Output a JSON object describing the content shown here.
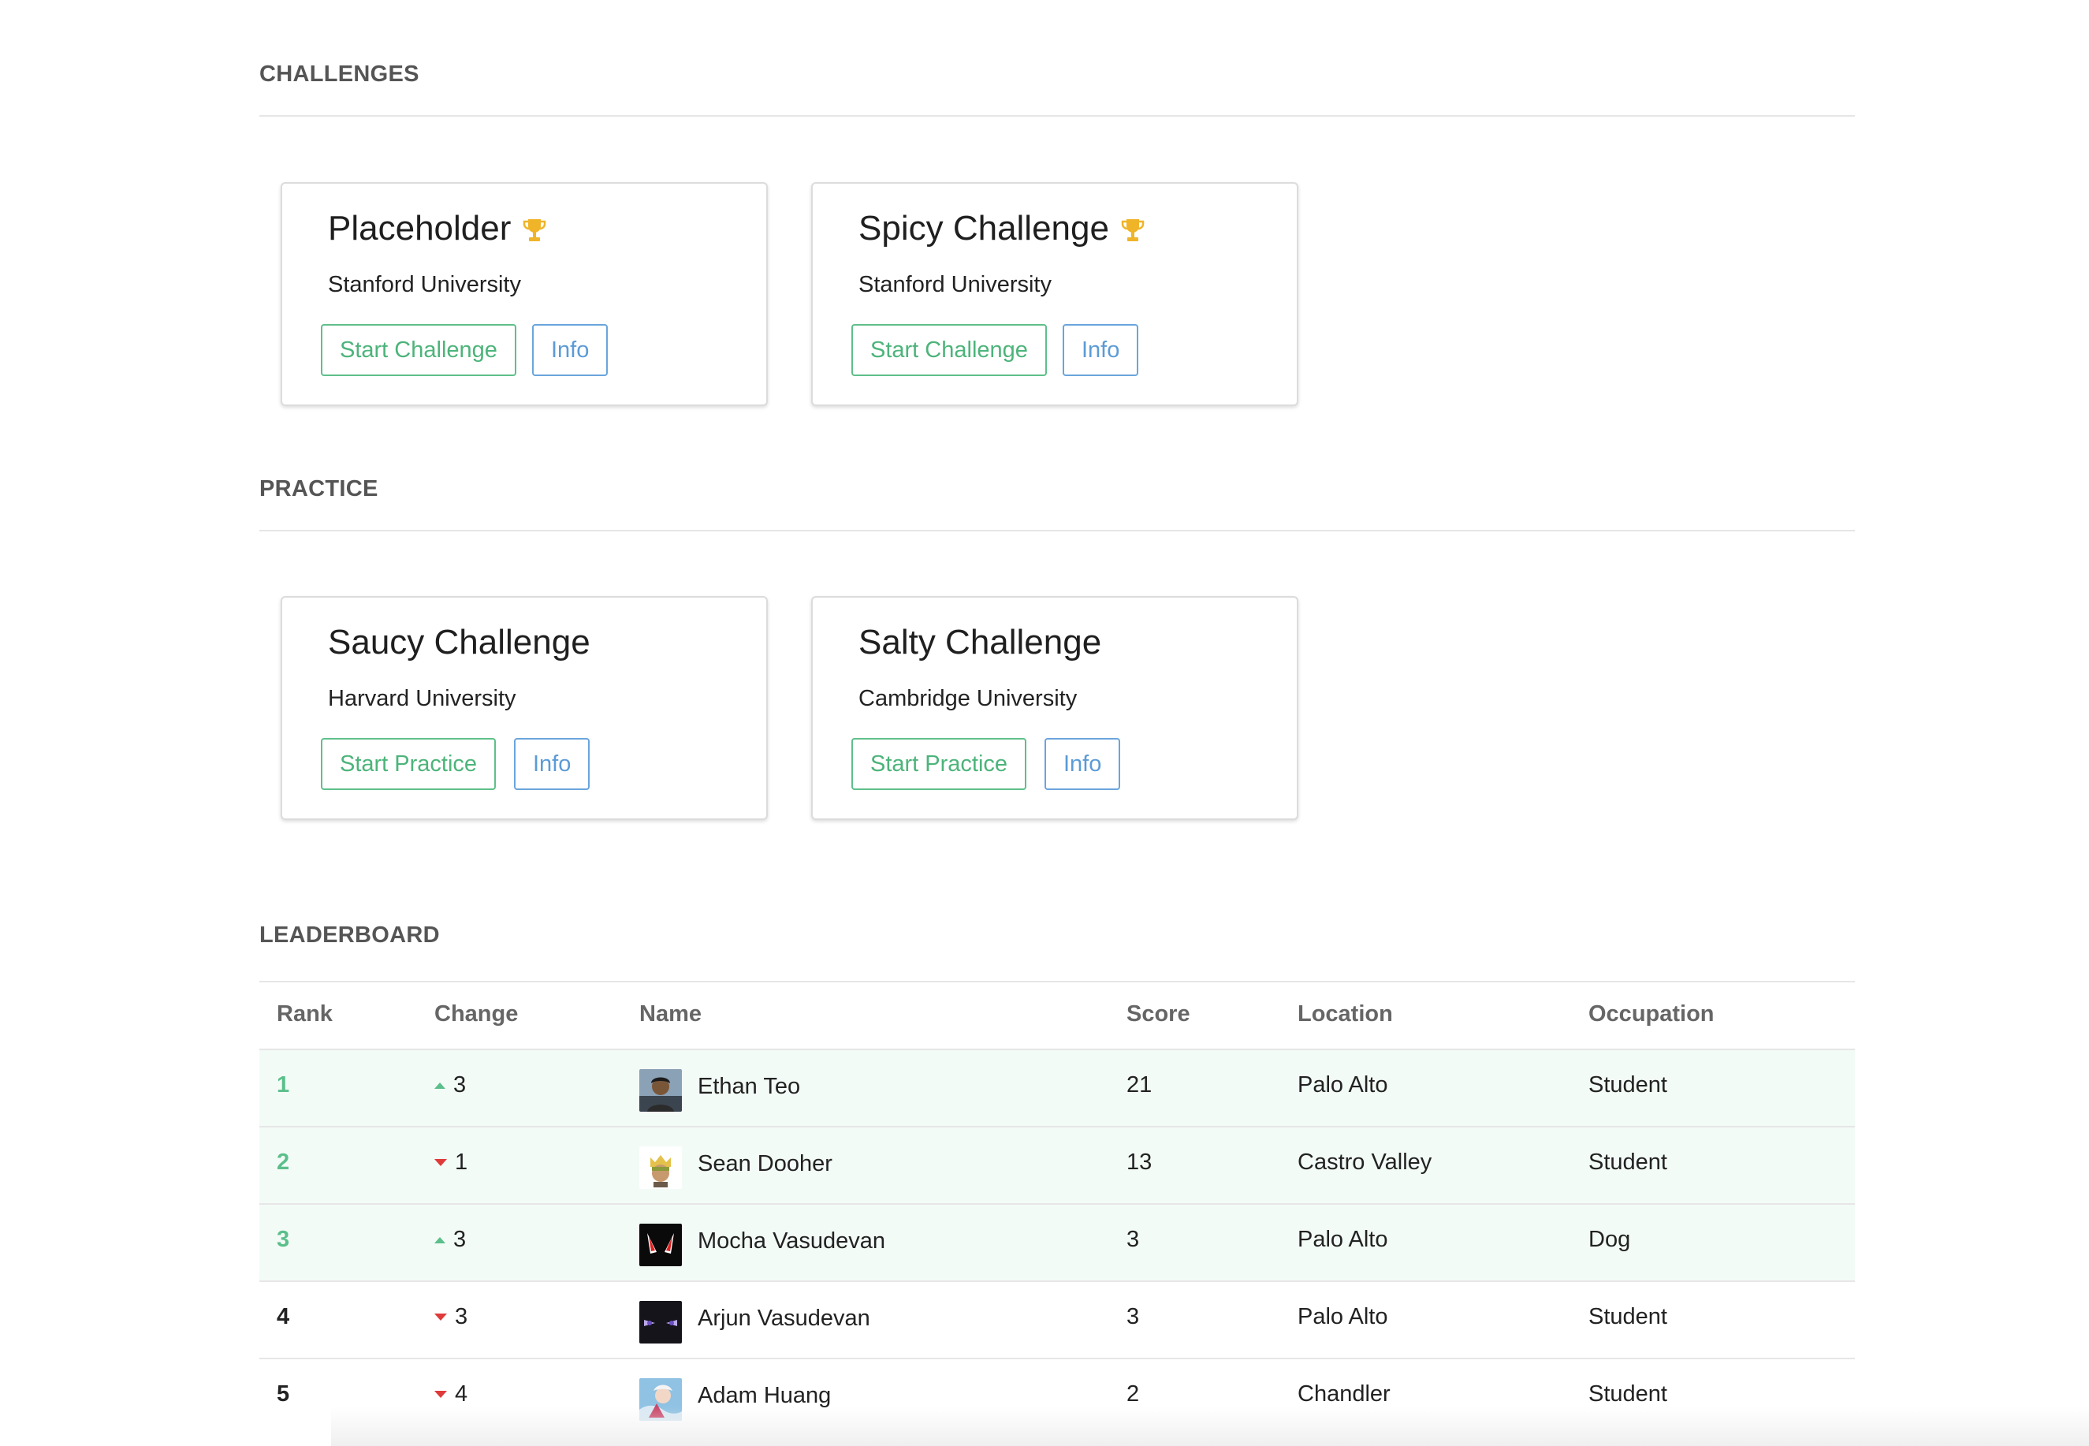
{
  "sections": {
    "challenges": "CHALLENGES",
    "practice": "PRACTICE",
    "leaderboard": "LEADERBOARD"
  },
  "challenges": [
    {
      "title": "Placeholder",
      "org": "Stanford University",
      "primary": "Start Challenge",
      "info": "Info",
      "icon": "trophy-icon"
    },
    {
      "title": "Spicy Challenge",
      "org": "Stanford University",
      "primary": "Start Challenge",
      "info": "Info",
      "icon": "trophy-icon"
    }
  ],
  "practice": [
    {
      "title": "Saucy Challenge",
      "org": "Harvard University",
      "primary": "Start Practice",
      "info": "Info"
    },
    {
      "title": "Salty Challenge",
      "org": "Cambridge University",
      "primary": "Start Practice",
      "info": "Info"
    }
  ],
  "leaderboard": {
    "headers": [
      "Rank",
      "Change",
      "Name",
      "Score",
      "Location",
      "Occupation"
    ],
    "rows": [
      {
        "rank": "1",
        "direction": "up",
        "change": "3",
        "name": "Ethan Teo",
        "score": "21",
        "location": "Palo Alto",
        "occupation": "Student"
      },
      {
        "rank": "2",
        "direction": "down",
        "change": "1",
        "name": "Sean Dooher",
        "score": "13",
        "location": "Castro Valley",
        "occupation": "Student"
      },
      {
        "rank": "3",
        "direction": "up",
        "change": "3",
        "name": "Mocha Vasudevan",
        "score": "3",
        "location": "Palo Alto",
        "occupation": "Dog"
      },
      {
        "rank": "4",
        "direction": "down",
        "change": "3",
        "name": "Arjun Vasudevan",
        "score": "3",
        "location": "Palo Alto",
        "occupation": "Student"
      },
      {
        "rank": "5",
        "direction": "down",
        "change": "4",
        "name": "Adam Huang",
        "score": "2",
        "location": "Chandler",
        "occupation": "Student"
      }
    ]
  },
  "colors": {
    "green": "#5bbf8b",
    "blue": "#5b9bd6",
    "red": "#e03a3a",
    "trophy": "#f0b429",
    "highlight_row": "#f3fbf6"
  }
}
